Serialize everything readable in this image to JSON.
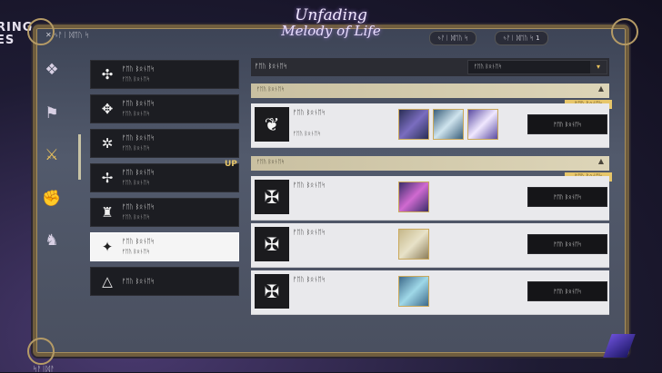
{
  "game": {
    "logo_line1": "Unfading",
    "logo_line2": "Melody of Life",
    "corner_text_line1": "RING",
    "corner_text_line2": "ES"
  },
  "header": {
    "back_label": "ᛃᚨᛁ ᛞᛖᚢ ᛋ",
    "pill_left": "ᛃᚨᛁ ᛞᛖᚢ ᛋ",
    "pill_right": "ᛃᚨᛁ ᛞᛖᚢ ᛋ  1"
  },
  "rail": {
    "icons": [
      "diamond-spark-icon",
      "banner-icon",
      "crossed-swords-icon",
      "fist-icon",
      "bust-icon"
    ]
  },
  "categories": [
    {
      "title": "ᚠᛖᚢ ᛒᛟᚾᛖᛋ",
      "subtitle": "ᚠᛖᚢ ᛒᛟᚾᛖᛋ",
      "icon": "✣",
      "selected": false
    },
    {
      "title": "ᚠᛖᚢ ᛒᛟᚾᛖᛋ",
      "subtitle": "ᚠᛖᚢ ᛒᛟᚾᛖᛋ",
      "icon": "✥",
      "selected": false
    },
    {
      "title": "ᚠᛖᚢ ᛒᛟᚾᛖᛋ",
      "subtitle": "ᚠᛖᚢ ᛒᛟᚾᛖᛋ",
      "icon": "✲",
      "selected": false
    },
    {
      "title": "ᚠᛖᚢ ᛒᛟᚾᛖᛋ",
      "subtitle": "ᚠᛖᚢ ᛒᛟᚾᛖᛋ",
      "icon": "✢",
      "selected": false
    },
    {
      "title": "ᚠᛖᚢ ᛒᛟᚾᛖᛋ",
      "subtitle": "ᚠᛖᚢ ᛒᛟᚾᛖᛋ",
      "icon": "♜",
      "selected": false
    },
    {
      "title": "ᚠᛖᚢ ᛒᛟᚾᛖᛋ",
      "subtitle": "ᚠᛖᚢ ᛒᛟᚾᛖᛋ",
      "icon": "✦",
      "selected": true
    },
    {
      "title": "ᚠᛖᚢ ᛒᛟᚾᛖᛋ",
      "subtitle": "",
      "icon": "△",
      "selected": false
    }
  ],
  "up_label": "UP",
  "panel": {
    "title": "ᚠᛖᚢ ᛒᛟᚾᛖᛋ",
    "dropdown_value": "ᚠᛖᚢ ᛒᛟᚾᛖᛋ",
    "sections": [
      {
        "label": "ᚠᛖᚢ ᛒᛟᚾᛖᛋ",
        "badge": "ᚠᛖᚢ ᛒᛟᚾᛖᛋ"
      },
      {
        "label": "ᚠᛖᚢ ᛒᛟᚾᛖᛋ",
        "badge": "ᚠᛖᚢ ᛒᛟᚾᛖᛋ"
      }
    ],
    "rows": [
      {
        "name": "ᚠᛖᚢ ᛒᛟᚾᛖᛋ",
        "sub": "ᚠᛖᚢ ᛒᛟᚾᛖᛋ",
        "button": "ᚠᛖᚢ ᛒᛟᚾᛖᛋ",
        "icon": "❦"
      },
      {
        "name": "ᚠᛖᚢ ᛒᛟᚾᛖᛋ",
        "sub": "",
        "button": "ᚠᛖᚢ ᛒᛟᚾᛖᛋ",
        "icon": "✠"
      },
      {
        "name": "ᚠᛖᚢ ᛒᛟᚾᛖᛋ",
        "sub": "",
        "button": "ᚠᛖᚢ ᛒᛟᚾᛖᛋ",
        "icon": "✠"
      },
      {
        "name": "ᚠᛖᚢ ᛒᛟᚾᛖᛋ",
        "sub": "",
        "button": "ᚠᛖᚢ ᛒᛟᚾᛖᛋ",
        "icon": "✠"
      }
    ]
  },
  "bottom_text": "ᛋᚨᛁᛞᚨ"
}
